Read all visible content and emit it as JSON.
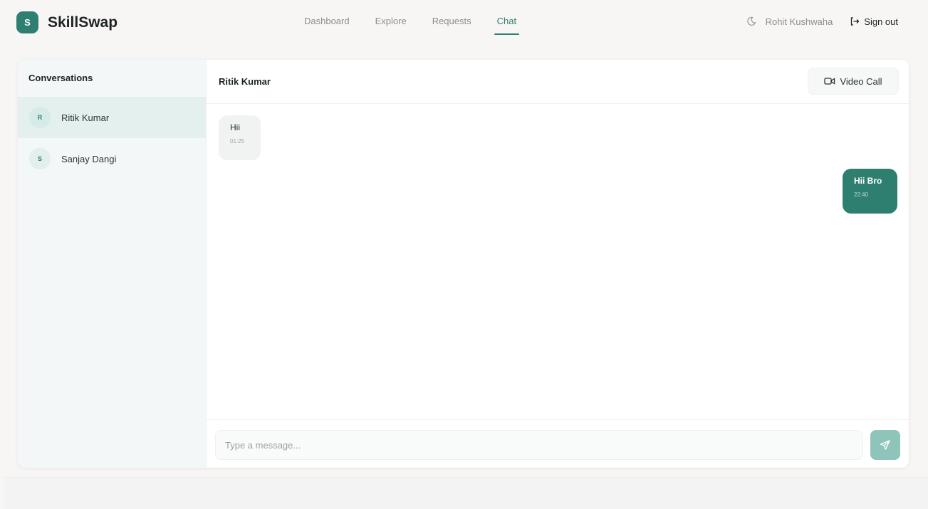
{
  "brand": {
    "logo_letter": "S",
    "name": "SkillSwap"
  },
  "nav": {
    "items": [
      {
        "label": "Dashboard"
      },
      {
        "label": "Explore"
      },
      {
        "label": "Requests"
      },
      {
        "label": "Chat",
        "active": true
      }
    ]
  },
  "user": {
    "name": "Rohit Kushwaha",
    "signout_label": "Sign out",
    "theme_icon": "moon-icon"
  },
  "sidebar": {
    "title": "Conversations",
    "conversations": [
      {
        "initial": "R",
        "name": "Ritik Kumar",
        "active": true
      },
      {
        "initial": "S",
        "name": "Sanjay Dangi",
        "active": false
      }
    ]
  },
  "chat": {
    "title": "Ritik Kumar",
    "video_call_label": "Video Call",
    "messages": [
      {
        "direction": "in",
        "text": "Hii",
        "time": "01:25"
      },
      {
        "direction": "out",
        "text": "Hii Bro",
        "time": "22:40"
      }
    ],
    "input": {
      "placeholder": "Type a message...",
      "value": ""
    }
  },
  "colors": {
    "accent": "#2f7f70",
    "send_button": "#8fc4ba",
    "active_conversation": "#e3f0ee"
  }
}
